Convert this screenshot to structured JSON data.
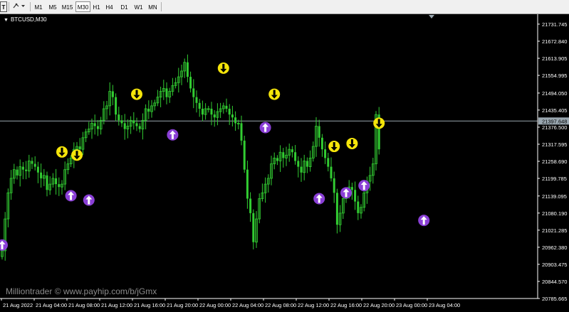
{
  "toolbar": {
    "timeframes": [
      "M1",
      "M5",
      "M15",
      "M30",
      "H1",
      "H4",
      "D1",
      "W1",
      "MN"
    ],
    "active_timeframe": "M30"
  },
  "chart_title": "BTCUSD,M30",
  "watermark": "Milliontrader © www.payhip.com/b/jGmx",
  "current_price": "21397.648",
  "colors": {
    "background": "#000000",
    "candle": "#32cd32",
    "axis": "#ffffff",
    "sell_arrow": "#f5e50a",
    "buy_arrow": "#8a3fd6",
    "price_line": "#9aa7b0"
  },
  "chart_data": {
    "type": "candlestick",
    "symbol": "BTCUSD",
    "timeframe": "M30",
    "ylim": [
      20785.63,
      21761.0
    ],
    "y_ticks": [
      "21731.745",
      "21672.840",
      "21613.905",
      "21554.995",
      "21494.050",
      "21435.405",
      "21376.500",
      "21317.595",
      "21258.690",
      "21199.785",
      "21139.095",
      "21080.190",
      "21021.285",
      "20962.380",
      "20903.475",
      "20844.570",
      "20785.665"
    ],
    "x_ticks": [
      "21 Aug 2022",
      "21 Aug 04:00",
      "21 Aug 08:00",
      "21 Aug 12:00",
      "21 Aug 16:00",
      "21 Aug 20:00",
      "22 Aug 00:00",
      "22 Aug 04:00",
      "22 Aug 08:00",
      "22 Aug 12:00",
      "22 Aug 16:00",
      "22 Aug 20:00",
      "23 Aug 00:00",
      "23 Aug 04:00"
    ],
    "close": [
      20950,
      21060,
      21150,
      21200,
      21230,
      21210,
      21240,
      21230,
      21225,
      21260,
      21250,
      21240,
      21220,
      21200,
      21210,
      21160,
      21180,
      21200,
      21180,
      21170,
      21180,
      21230,
      21250,
      21270,
      21300,
      21310,
      21300,
      21340,
      21360,
      21370,
      21390,
      21380,
      21370,
      21400,
      21440,
      21450,
      21500,
      21480,
      21420,
      21400,
      21390,
      21370,
      21380,
      21400,
      21390,
      21380,
      21370,
      21400,
      21440,
      21430,
      21450,
      21460,
      21480,
      21500,
      21510,
      21480,
      21500,
      21520,
      21530,
      21550,
      21570,
      21600,
      21550,
      21510,
      21480,
      21460,
      21440,
      21420,
      21440,
      21440,
      21420,
      21410,
      21430,
      21440,
      21450,
      21440,
      21420,
      21410,
      21390,
      21390,
      21330,
      21230,
      21130,
      21080,
      20980,
      21060,
      21130,
      21150,
      21180,
      21200,
      21250,
      21270,
      21260,
      21290,
      21270,
      21280,
      21300,
      21290,
      21260,
      21240,
      21220,
      21260,
      21240,
      21270,
      21310,
      21380,
      21340,
      21300,
      21270,
      21240,
      21200,
      21150,
      21040,
      21080,
      21130,
      21140,
      21170,
      21160,
      21120,
      21080,
      21100,
      21150,
      21190,
      21210,
      21250,
      21420,
      21300
    ],
    "sell_signals": [
      {
        "index": 20,
        "price": 21291
      },
      {
        "index": 25,
        "price": 21280
      },
      {
        "index": 45,
        "price": 21490
      },
      {
        "index": 74,
        "price": 21580
      },
      {
        "index": 91,
        "price": 21490
      },
      {
        "index": 111,
        "price": 21310
      },
      {
        "index": 117,
        "price": 21320
      },
      {
        "index": 126,
        "price": 21390
      }
    ],
    "buy_signals": [
      {
        "index": 0,
        "price": 20970
      },
      {
        "index": 23,
        "price": 21140
      },
      {
        "index": 29,
        "price": 21125
      },
      {
        "index": 57,
        "price": 21350
      },
      {
        "index": 88,
        "price": 21375
      },
      {
        "index": 106,
        "price": 21130
      },
      {
        "index": 115,
        "price": 21150
      },
      {
        "index": 121,
        "price": 21175
      },
      {
        "index": 141,
        "price": 21055
      }
    ]
  }
}
